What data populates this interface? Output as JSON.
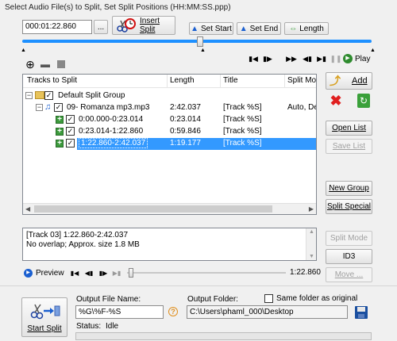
{
  "header": {
    "instructions": "Select Audio File(s) to Split, Set Split Positions (HH:MM:SS.ppp)"
  },
  "position": {
    "time_value": "000:01:22.860",
    "browse_label": "...",
    "insert_split_label": "Insert Split",
    "set_start_label": "Set Start",
    "set_end_label": "Set End",
    "length_label": "Length"
  },
  "player": {
    "play_label": "Play"
  },
  "table": {
    "columns": [
      "Tracks to Split",
      "Length",
      "Title",
      "Split Mod"
    ],
    "group_name": "Default Split Group",
    "file": {
      "name": "09- Romanza mp3.mp3",
      "length": "2:42.037",
      "title": "[Track %S]",
      "mode": "Auto, De"
    },
    "tracks": [
      {
        "range": "0:00.000-0:23.014",
        "length": "0:23.014",
        "title": "[Track %S]"
      },
      {
        "range": "0:23.014-1:22.860",
        "length": "0:59.846",
        "title": "[Track %S]"
      },
      {
        "range": "1:22.860-2:42.037",
        "length": "1:19.177",
        "title": "[Track %S]"
      }
    ]
  },
  "side_buttons": {
    "add": "Add",
    "open_list": "Open List",
    "save_list": "Save List",
    "new_group": "New Group",
    "split_special": "Split Special",
    "split_mode": "Split Mode",
    "id3": "ID3",
    "move": "Move ..."
  },
  "info": {
    "line1": "[Track 03] 1:22.860-2:42.037",
    "line2": "No overlap; Approx. size 1.8 MB"
  },
  "preview": {
    "label": "Preview",
    "time": "1:22.860"
  },
  "output": {
    "start_split_label": "Start Split",
    "file_name_label": "Output File Name:",
    "file_name_value": "%G\\%F-%S",
    "help_label": "?",
    "folder_label": "Output Folder:",
    "same_folder_label": "Same folder as original",
    "folder_value": "C:\\Users\\phaml_000\\Desktop",
    "status_label": "Status:",
    "status_value": "Idle"
  },
  "colors": {
    "selection": "#3399ff",
    "slider": "#1e90ff",
    "panel": "#f0f0f0"
  }
}
